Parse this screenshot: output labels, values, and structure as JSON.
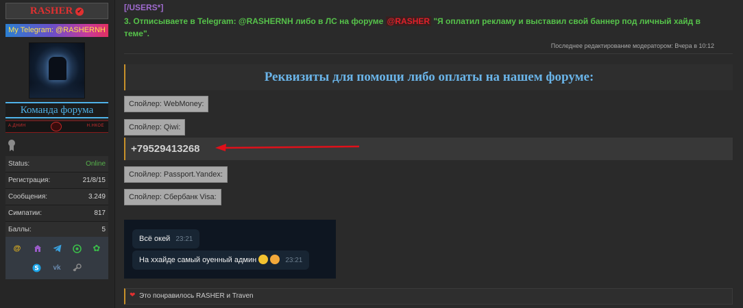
{
  "user": {
    "name": "RASHER",
    "telegram_link": "My Telegram: @RASHERNH",
    "team_title": "Команда форума",
    "banner_left": "А.ДНИН",
    "banner_right": "Н.НКОЕ",
    "stats": [
      {
        "label": "Status:",
        "value": "Online"
      },
      {
        "label": "Регистрация:",
        "value": "21/8/15"
      },
      {
        "label": "Сообщения:",
        "value": "3.249"
      },
      {
        "label": "Симпатии:",
        "value": "817"
      },
      {
        "label": "Баллы:",
        "value": "5"
      }
    ],
    "social_icons": [
      "at-icon",
      "home-icon",
      "telegram-icon",
      "whatsapp-icon",
      "icq-icon",
      "skype-icon",
      "vk-icon",
      "steam-icon"
    ],
    "colors": {
      "name": "#e03030",
      "team": "#4fb3ea",
      "online": "#56b24b"
    }
  },
  "post": {
    "users_tag": "[/USERS*]",
    "instruction_parts": {
      "before": "3. Отписываете в Telegram: @RASHERNH либо в ЛС на форуме ",
      "mention": "@RASHER",
      "after": " \"Я оплатил рекламу и выставил свой баннер под личный хайд в теме\"."
    },
    "edited_note": "Последнее редактирование модератором: Вчера в 10:12",
    "requisites_title": "Реквизиты для помощи либо оплаты на нашем форуме:",
    "spoilers": [
      "Спойлер: WebMoney:",
      "Спойлер: Qiwi:",
      "Спойлер: Passport.Yandex:",
      "Спойлер: Сбербанк Visa:"
    ],
    "phone": "+79529413268",
    "chat": [
      {
        "text": "Всё окей",
        "time": "23:21"
      },
      {
        "text": "На ххайде самый оуенный админ",
        "time": "23:21"
      }
    ],
    "likes_text": "Это понравилось RASHER и Traven",
    "colors": {
      "green": "#56c24a",
      "mention": "#e0202a",
      "purple": "#a06bd0",
      "title": "#6ab4e8",
      "arrow": "#e0101a"
    }
  }
}
